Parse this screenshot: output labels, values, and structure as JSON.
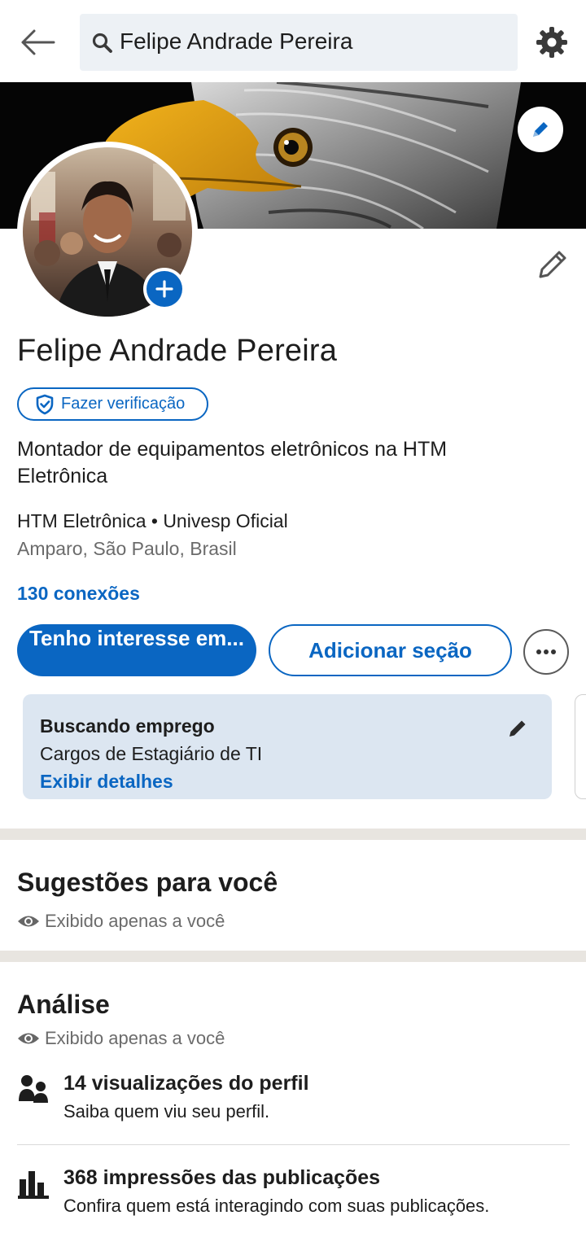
{
  "search": {
    "value": "Felipe Andrade Pereira"
  },
  "profile": {
    "name": "Felipe Andrade Pereira",
    "verify_label": "Fazer verificação",
    "headline": "Montador de equipamentos eletrônicos na HTM Eletrônica",
    "org_line": "HTM Eletrônica • Univesp Oficial",
    "location": "Amparo, São Paulo, Brasil",
    "connections": "130 conexões"
  },
  "actions": {
    "primary": "Tenho interesse em...",
    "secondary": "Adicionar seção"
  },
  "open_to_work": {
    "title": "Buscando emprego",
    "roles": "Cargos de Estagiário de TI",
    "link": "Exibir detalhes"
  },
  "suggestions": {
    "title": "Sugestões para você",
    "visibility": "Exibido apenas a você"
  },
  "analytics": {
    "title": "Análise",
    "visibility": "Exibido apenas a você",
    "items": [
      {
        "headline": "14 visualizações do perfil",
        "description": "Saiba quem viu seu perfil.",
        "icon": "people-icon"
      },
      {
        "headline": "368 impressões das publicações",
        "description": "Confira quem está interagindo com suas publicações.",
        "icon": "bar-chart-icon"
      }
    ]
  },
  "colors": {
    "brand": "#0a66c2",
    "job_card": "#dce6f1",
    "divider": "#e8e5e0"
  }
}
